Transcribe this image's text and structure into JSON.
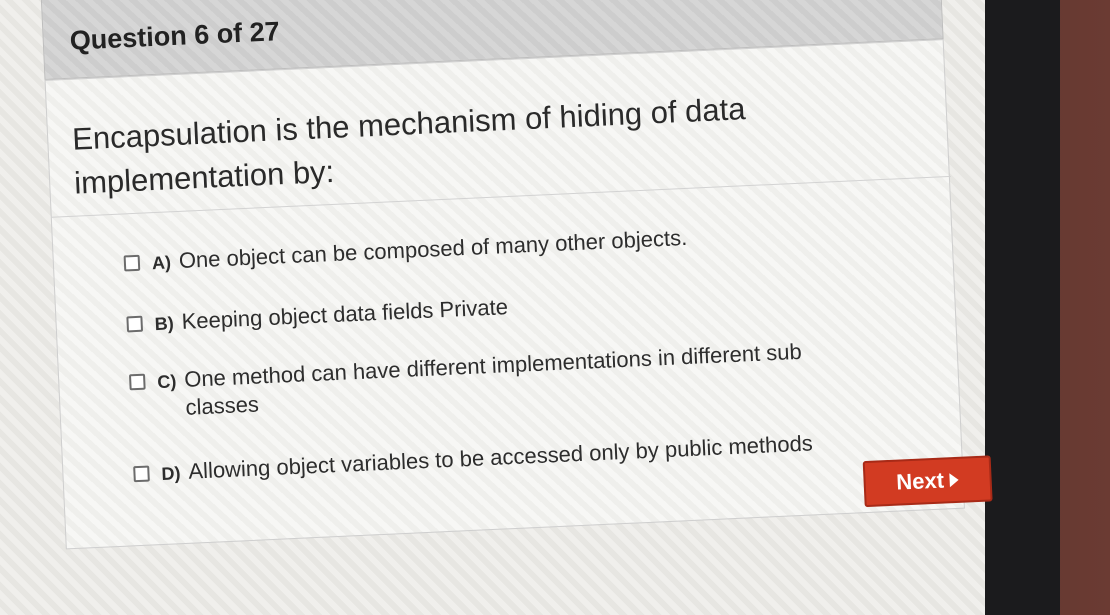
{
  "question": {
    "header": "Question 6 of 27",
    "text": "Encapsulation is the mechanism of hiding of data implementation by:",
    "options": [
      {
        "letter": "A)",
        "text": "One object can be composed of many other objects.",
        "checked": false
      },
      {
        "letter": "B)",
        "text": "Keeping object data fields Private",
        "checked": false
      },
      {
        "letter": "C)",
        "text": "One method can have different implementations in different sub classes",
        "checked": false
      },
      {
        "letter": "D)",
        "text": "Allowing object variables to be accessed only by public methods",
        "checked": false
      }
    ]
  },
  "navigation": {
    "next_label": "Next",
    "next_icon": "play-arrow-icon"
  },
  "colors": {
    "next_button": "#d23b22",
    "header_background": "#d6d6d6"
  }
}
